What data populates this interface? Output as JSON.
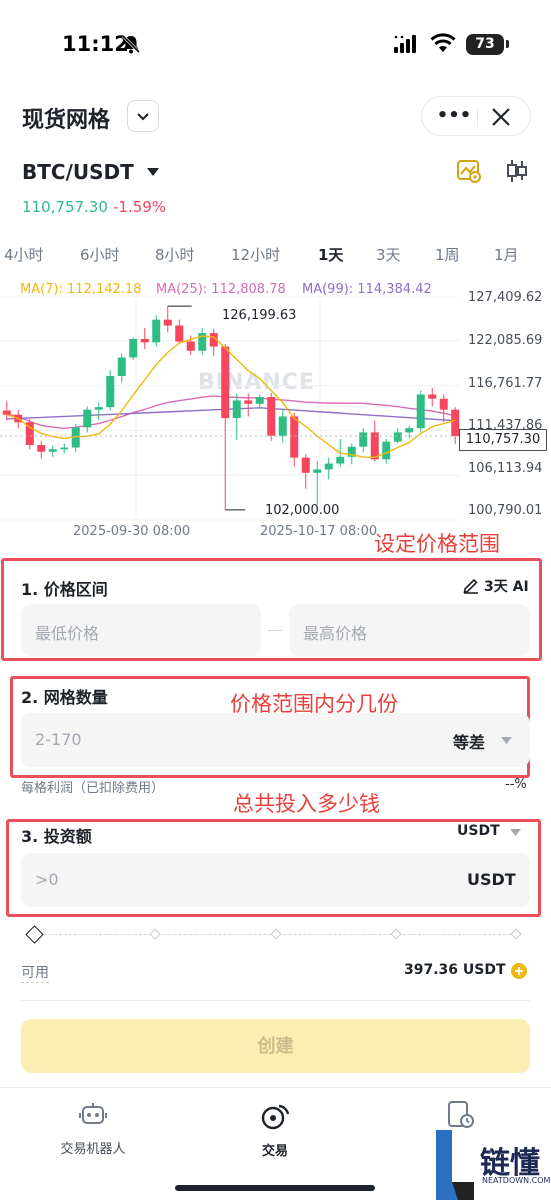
{
  "status": {
    "time": "11:12",
    "battery": "73"
  },
  "header": {
    "title": "现货网格"
  },
  "pair": {
    "symbol": "BTC/USDT",
    "price": "110,757.30",
    "change": "-1.59%"
  },
  "colors": {
    "up": "#2ebd85",
    "down": "#f6465d",
    "ma7": "#f0b90b",
    "ma25": "#d96bb5",
    "ma99": "#8e6fc9",
    "annotation": "#e8403a"
  },
  "tabs": [
    {
      "label": "4小时"
    },
    {
      "label": "6小时"
    },
    {
      "label": "8小时"
    },
    {
      "label": "12小时"
    },
    {
      "label": "1天",
      "active": true
    },
    {
      "label": "3天"
    },
    {
      "label": "1周"
    },
    {
      "label": "1月"
    }
  ],
  "ma": {
    "ma7": "MA(7): 112,142.18",
    "ma25": "MA(25): 112,808.78",
    "ma99": "MA(99): 114,384.42"
  },
  "chart_data": {
    "type": "candlestick",
    "y_ticks": [
      "127,409.62",
      "122,085.69",
      "116,761.77",
      "111,437.86",
      "106,113.94",
      "100,790.01"
    ],
    "x_ticks": [
      "2025-09-30 08:00",
      "2025-10-17 08:00"
    ],
    "ylim": [
      100790.01,
      127409.62
    ],
    "high_label": "126,199.63",
    "low_label": "102,000.00",
    "current_price": "110,757.30",
    "watermark": "BINANCE",
    "candles": [
      [
        113800,
        114900,
        112600,
        113300
      ],
      [
        113300,
        113900,
        111700,
        112400
      ],
      [
        112400,
        112800,
        109200,
        109700
      ],
      [
        109700,
        110200,
        108100,
        108900
      ],
      [
        108900,
        109600,
        108300,
        109200
      ],
      [
        109200,
        109900,
        108700,
        109400
      ],
      [
        109400,
        112200,
        108900,
        111800
      ],
      [
        111800,
        114300,
        111200,
        113900
      ],
      [
        113900,
        114700,
        112600,
        114200
      ],
      [
        114200,
        118600,
        113800,
        117900
      ],
      [
        117900,
        120600,
        117100,
        120100
      ],
      [
        120100,
        122500,
        119800,
        122300
      ],
      [
        122300,
        123600,
        121100,
        121900
      ],
      [
        121900,
        125100,
        121400,
        124600
      ],
      [
        124600,
        126200,
        123100,
        123900
      ],
      [
        123900,
        124600,
        121700,
        122000
      ],
      [
        122000,
        122700,
        120400,
        120900
      ],
      [
        120900,
        123600,
        120400,
        123000
      ],
      [
        123000,
        123500,
        120300,
        121400
      ],
      [
        121400,
        121700,
        102000,
        112900
      ],
      [
        112900,
        115800,
        110300,
        115000
      ],
      [
        115000,
        115800,
        113100,
        114600
      ],
      [
        114600,
        115700,
        114000,
        115400
      ],
      [
        115400,
        115900,
        110200,
        110800
      ],
      [
        110800,
        113900,
        110000,
        113100
      ],
      [
        113100,
        113500,
        107100,
        108200
      ],
      [
        108200,
        108600,
        104500,
        106400
      ],
      [
        106400,
        107800,
        102600,
        106800
      ],
      [
        106800,
        108200,
        105600,
        107500
      ],
      [
        107500,
        110400,
        107100,
        108300
      ],
      [
        108300,
        109900,
        107400,
        109500
      ],
      [
        109500,
        111700,
        108800,
        111200
      ],
      [
        111200,
        112600,
        107800,
        108000
      ],
      [
        108000,
        110400,
        107500,
        110100
      ],
      [
        110100,
        111700,
        109900,
        111200
      ],
      [
        111200,
        112000,
        110500,
        111700
      ],
      [
        111700,
        116200,
        111200,
        115700
      ],
      [
        115700,
        116500,
        114300,
        115200
      ],
      [
        115200,
        115700,
        112400,
        113900
      ],
      [
        113900,
        114200,
        109800,
        110757
      ]
    ]
  },
  "form": {
    "annotation_range": "设定价格范围",
    "annotation_grids": "价格范围内分几份",
    "annotation_invest": "总共投入多少钱",
    "price_range_label": "1. 价格区间",
    "ai_label": "3天 AI",
    "min_price_placeholder": "最低价格",
    "max_price_placeholder": "最高价格",
    "grid_count_label": "2. 网格数量",
    "grid_count_placeholder": "2-170",
    "grid_mode": "等差",
    "profit_label": "每格利润（已扣除费用）",
    "profit_value": "--%",
    "invest_label": "3. 投资额",
    "invest_currency": "USDT",
    "invest_placeholder": ">0",
    "invest_unit": "USDT",
    "available_label": "可用",
    "available_value": "397.36 USDT",
    "create_button": "创建"
  },
  "nav": {
    "robot": "交易机器人",
    "trade": "交易"
  },
  "brand": {
    "name": "链懂",
    "sub": "NEATDOWN.COM"
  }
}
